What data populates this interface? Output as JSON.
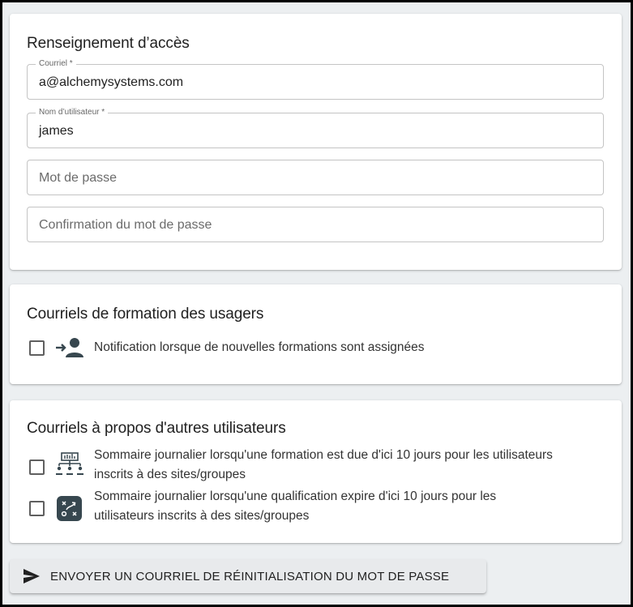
{
  "access_section": {
    "title": "Renseignement d’accès",
    "email": {
      "label": "Courriel *",
      "value": "a@alchemysystems.com"
    },
    "username": {
      "label": "Nom d’utilisateur *",
      "value": "james"
    },
    "password": {
      "placeholder": "Mot de passe"
    },
    "password_confirm": {
      "placeholder": "Confirmation du mot de passe"
    }
  },
  "training_section": {
    "title": "Courriels de formation des usagers",
    "options": [
      {
        "label": "Notification lorsque de nouvelles formations sont assignées",
        "icon": "user-assign-icon",
        "checked": false
      }
    ]
  },
  "others_section": {
    "title": "Courriels à propos d'autres utilisateurs",
    "options": [
      {
        "line1": "Sommaire journalier lorsqu'une formation est due d'ici 10 jours pour les utilisateurs",
        "line2": "inscrits à des sites/groupes",
        "icon": "org-chart-icon",
        "checked": false
      },
      {
        "line1": "Sommaire journalier lorsqu'une qualification expire d'ici 10 jours pour les",
        "line2": "utilisateurs inscrits à des sites/groupes",
        "icon": "strategy-icon",
        "checked": false
      }
    ]
  },
  "reset_button": {
    "label": "ENVOYER UN COURRIEL DE RÉINITIALISATION DU MOT DE PASSE",
    "icon": "send-icon"
  },
  "colors": {
    "background": "#eceff1",
    "card": "#ffffff",
    "border": "#c4c4c4",
    "icon_dark": "#37474f"
  }
}
